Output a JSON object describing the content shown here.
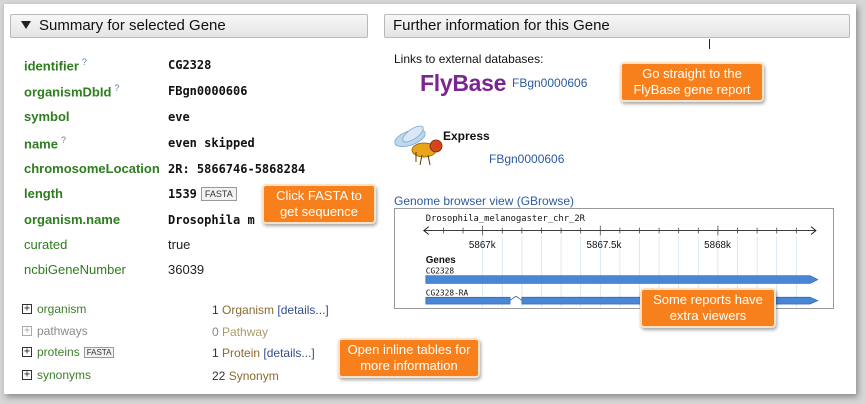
{
  "left_panel": {
    "title": "Summary for selected Gene"
  },
  "right_panel": {
    "title": "Further information for this Gene"
  },
  "fields": [
    {
      "label": "identifier",
      "help": "?",
      "value": "CG2328"
    },
    {
      "label": "organismDbId",
      "help": "?",
      "value": "FBgn0000606"
    },
    {
      "label": "symbol",
      "value": "eve"
    },
    {
      "label": "name",
      "help": "?",
      "value": "even skipped"
    },
    {
      "label": "chromosomeLocation",
      "value": "2R: 5866746-5868284"
    },
    {
      "label": "length",
      "value": "1539",
      "button": "FASTA"
    },
    {
      "label": "organism.name",
      "value": "Drosophila m"
    },
    {
      "label": "curated",
      "value": "true"
    },
    {
      "label": "ncbiGeneNumber",
      "value": "36039"
    }
  ],
  "collections": [
    {
      "label": "organism",
      "count": "1",
      "class": "Organism",
      "link": "[details...]"
    },
    {
      "label": "pathways",
      "count": "0",
      "class": "Pathway"
    },
    {
      "label": "proteins",
      "button": "FASTA",
      "count": "1",
      "class": "Protein",
      "link": "[details...]"
    },
    {
      "label": "synonyms",
      "count": "22",
      "class": "Synonym"
    }
  ],
  "external": {
    "links_label": "Links to external databases:",
    "flybase": {
      "logo": "FlyBase",
      "id": "FBgn0000606"
    },
    "flyexpress": {
      "logo": "Express",
      "id": "FBgn0000606"
    }
  },
  "gbrowse": {
    "label": "Genome browser view (GBrowse)",
    "track_title": "Drosophila_melanogaster_chr_2R",
    "ticks": [
      "5867k",
      "5867.5k",
      "5868k"
    ],
    "genes_label": "Genes",
    "gene": "CG2328",
    "transcript": "CG2328-RA"
  },
  "callouts": {
    "fasta": "Click FASTA to get sequence",
    "flybase": "Go straight to the FlyBase gene report",
    "viewers": "Some reports have extra viewers",
    "inline": "Open inline tables for more information"
  },
  "colors": {
    "label_green": "#2e7d1f",
    "callout_orange": "#f7801d",
    "flybase_purple": "#7b2590",
    "link_blue": "#2c5aa0"
  },
  "icons": [
    "collapse-triangle-icon",
    "expand-plus-icon",
    "flyexpress-fly-icon"
  ]
}
